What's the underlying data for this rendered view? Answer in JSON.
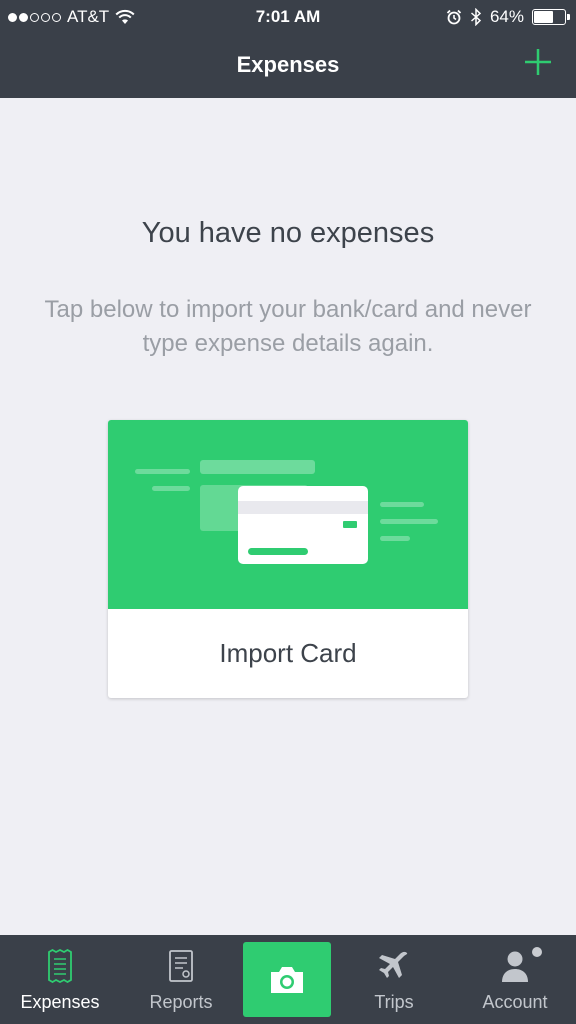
{
  "status_bar": {
    "carrier": "AT&T",
    "time": "7:01 AM",
    "battery": "64%",
    "battery_level": 0.64,
    "signal_bars": 2,
    "icons": [
      "wifi-icon",
      "alarm-icon",
      "bluetooth-icon",
      "battery-icon"
    ]
  },
  "header": {
    "title": "Expenses",
    "add_icon": "plus-icon"
  },
  "empty_state": {
    "title": "You have no expenses",
    "subtitle": "Tap below to import your bank/card and never type expense details again."
  },
  "import_card": {
    "label": "Import Card",
    "illustration": "credit-card-illustration"
  },
  "tab_bar": {
    "tabs": [
      {
        "label": "Expenses",
        "icon": "receipt-icon",
        "active": true
      },
      {
        "label": "Reports",
        "icon": "report-icon",
        "active": false
      },
      {
        "label": "",
        "icon": "camera-icon",
        "active": false
      },
      {
        "label": "Trips",
        "icon": "airplane-icon",
        "active": false
      },
      {
        "label": "Account",
        "icon": "person-icon",
        "active": false
      }
    ]
  },
  "colors": {
    "brand_green": "#2fcc71",
    "bar_background": "#3a4049",
    "page_background": "#efeff4"
  }
}
